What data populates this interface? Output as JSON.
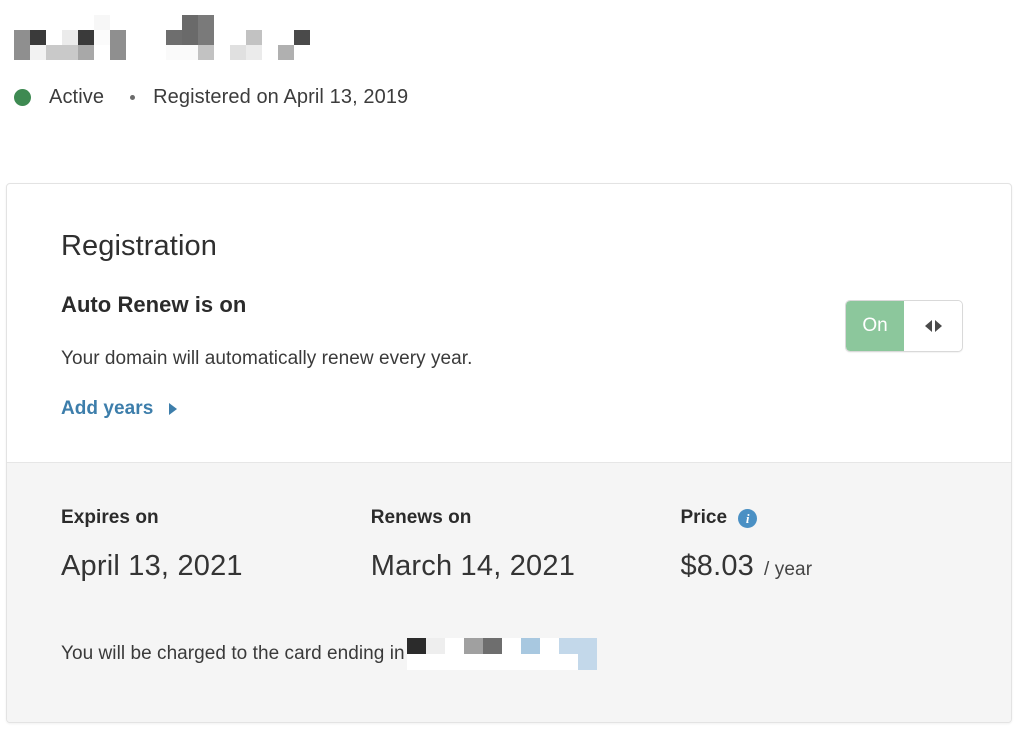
{
  "header": {
    "domain_redacted": {
      "alt": "redacted-domain-name",
      "groups": [
        {
          "columns": [
            [
              "#ffffff",
              "#8f8f8f",
              "#8f8f8f"
            ],
            [
              "#ffffff",
              "#3a3a3a",
              "#f2f2f2"
            ],
            [
              "#ffffff",
              "#ffffff",
              "#c9c9c9"
            ],
            [
              "#ffffff",
              "#ebebeb",
              "#c9c9c9"
            ],
            [
              "#ffffff",
              "#3a3a3a",
              "#a8a8a8"
            ],
            [
              "#f7f7f7",
              "#fbfbfb",
              "#ffffff"
            ],
            [
              "#ffffff",
              "#8f8f8f",
              "#8f8f8f"
            ]
          ]
        },
        {
          "columns": [
            [
              "#ffffff",
              "#6e6e6e",
              "#fafafa"
            ],
            [
              "#6a6a6a",
              "#6a6a6a",
              "#fafafa"
            ],
            [
              "#7a7a7a",
              "#7a7a7a",
              "#c2c2c2"
            ],
            [
              "#ffffff",
              "#ffffff",
              "#ffffff"
            ],
            [
              "#ffffff",
              "#ffffff",
              "#e0e0e0"
            ],
            [
              "#ffffff",
              "#c2c2c2",
              "#ebebeb"
            ],
            [
              "#ffffff",
              "#ffffff",
              "#ffffff"
            ],
            [
              "#ffffff",
              "#ffffff",
              "#b0b0b0"
            ],
            [
              "#ffffff",
              "#4a4a4a",
              "#ffffff"
            ]
          ]
        }
      ]
    },
    "status": {
      "dot_color": "#3e8a52",
      "label": "Active",
      "registered_text": "Registered on April 13, 2019"
    }
  },
  "card": {
    "title": "Registration",
    "auto_renew": {
      "heading": "Auto Renew is on",
      "description": "Your domain will automatically renew every year.",
      "add_years_label": "Add years",
      "toggle": {
        "state_label": "On",
        "on_color": "#8cc79c"
      }
    },
    "details": [
      {
        "label": "Expires on",
        "value": "April 13, 2021",
        "unit": ""
      },
      {
        "label": "Renews on",
        "value": "March 14, 2021",
        "unit": ""
      },
      {
        "label": "Price",
        "value": "$8.03",
        "unit": "/ year",
        "info_icon": "info-icon",
        "info_color": "#4a90c4"
      }
    ],
    "charge_note": {
      "text": "You will be charged to the card ending in",
      "card_redacted": {
        "alt": "redacted-card-digits",
        "columns": [
          [
            "#2b2b2b",
            "#ffffff"
          ],
          [
            "#eeeeee",
            "#ffffff"
          ],
          [
            "#ffffff",
            "#ffffff"
          ],
          [
            "#a0a0a0",
            "#ffffff"
          ],
          [
            "#6e6e6e",
            "#ffffff"
          ],
          [
            "#ffffff",
            "#ffffff"
          ],
          [
            "#a8c8e0",
            "#ffffff"
          ],
          [
            "#ffffff",
            "#ffffff"
          ],
          [
            "#c3d8ea",
            "#ffffff"
          ],
          [
            "#c3d8ea",
            "#c3d8ea"
          ]
        ]
      }
    }
  }
}
